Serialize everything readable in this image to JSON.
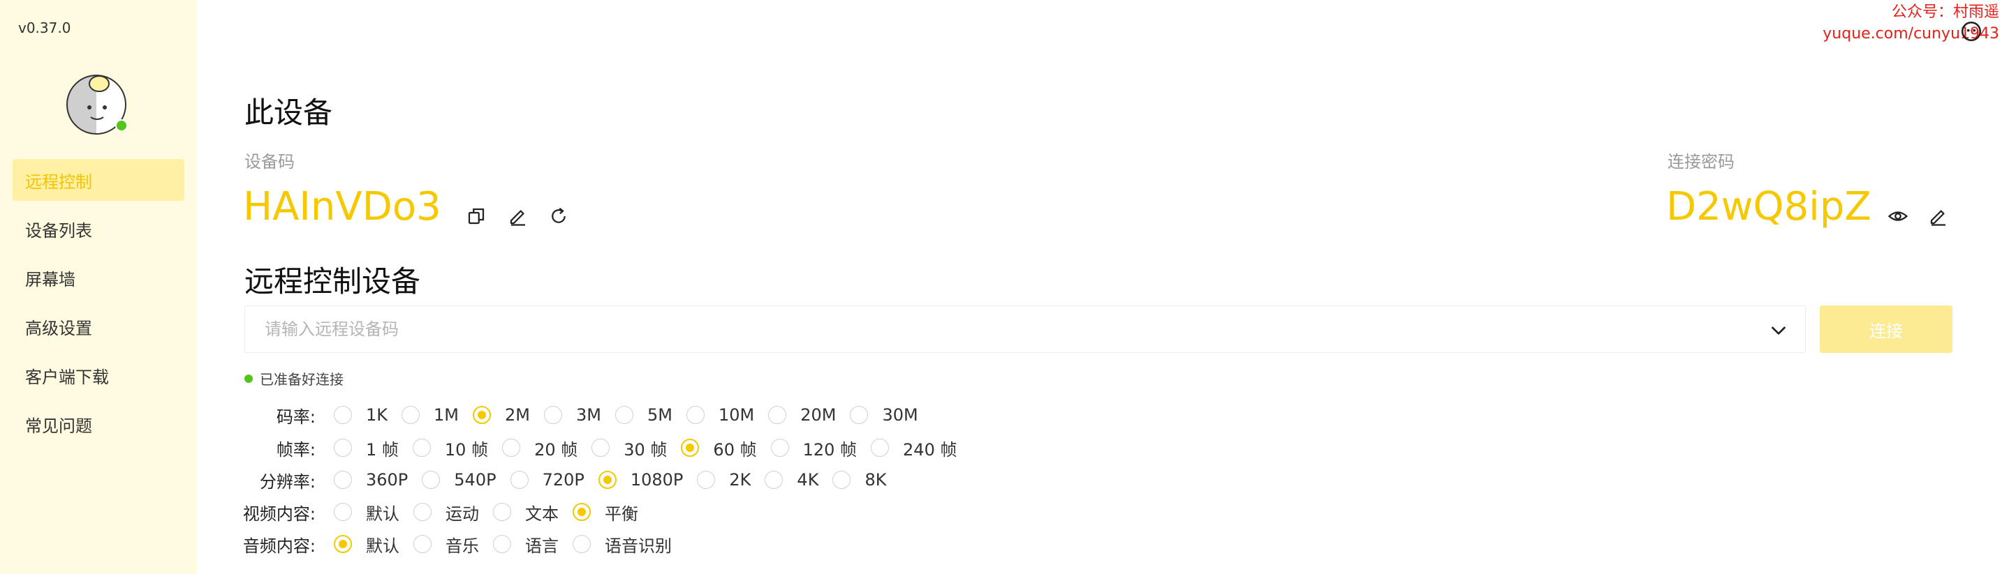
{
  "app": {
    "version": "v0.37.0"
  },
  "sidebar": {
    "items": [
      {
        "label": "远程控制",
        "active": true
      },
      {
        "label": "设备列表",
        "active": false
      },
      {
        "label": "屏幕墙",
        "active": false
      },
      {
        "label": "高级设置",
        "active": false
      },
      {
        "label": "客户端下载",
        "active": false
      },
      {
        "label": "常见问题",
        "active": false
      }
    ]
  },
  "device": {
    "title": "此设备",
    "code_label": "设备码",
    "code": "HAInVDo3",
    "password_label": "连接密码",
    "password": "D2wQ8ipZ"
  },
  "remote": {
    "title": "远程控制设备",
    "input_placeholder": "请输入远程设备码",
    "input_value": "",
    "connect_label": "连接",
    "status": "已准备好连接"
  },
  "options": {
    "bitrate": {
      "label": "码率:",
      "values": [
        "1K",
        "1M",
        "2M",
        "3M",
        "5M",
        "10M",
        "20M",
        "30M"
      ],
      "selected": "2M"
    },
    "framerate": {
      "label": "帧率:",
      "values": [
        "1 帧",
        "10 帧",
        "20 帧",
        "30 帧",
        "60 帧",
        "120 帧",
        "240 帧"
      ],
      "selected": "60 帧"
    },
    "resolution": {
      "label": "分辨率:",
      "values": [
        "360P",
        "540P",
        "720P",
        "1080P",
        "2K",
        "4K",
        "8K"
      ],
      "selected": "1080P"
    },
    "video_content": {
      "label": "视频内容:",
      "values": [
        "默认",
        "运动",
        "文本",
        "平衡"
      ],
      "selected": "平衡"
    },
    "audio_content": {
      "label": "音频内容:",
      "values": [
        "默认",
        "音乐",
        "语言",
        "语音识别"
      ],
      "selected": "默认"
    }
  },
  "watermark": {
    "line1": "公众号：村雨遥",
    "line2": "yuque.com/cunyu1943"
  },
  "colors": {
    "accent": "#f5c800",
    "sidebar_bg": "#fffbe0",
    "active_item_bg": "#fff0a3",
    "status_ok": "#52c41a",
    "watermark": "#e8201a"
  },
  "icons": [
    "copy-icon",
    "edit-icon",
    "refresh-icon",
    "eye-icon",
    "chevron-down-icon",
    "avatar-mascot"
  ]
}
